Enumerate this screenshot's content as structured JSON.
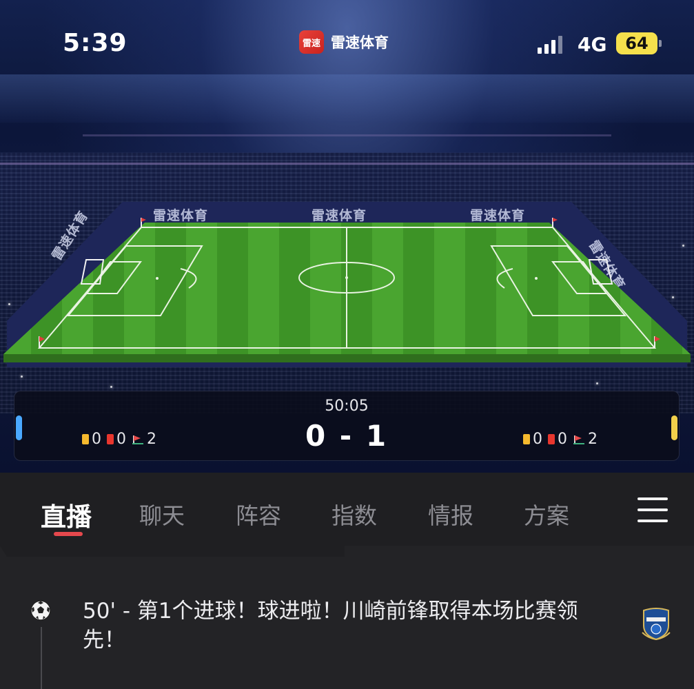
{
  "status_bar": {
    "time": "5:39",
    "network": "4G",
    "battery": "64",
    "signal_bars": 4,
    "app_name": "雷速体育",
    "app_logo_text": "雷速"
  },
  "stadium": {
    "ad_boards": [
      "雷速体育",
      "雷速体育",
      "雷速体育",
      "雷速体育",
      "雷速体育"
    ]
  },
  "scoreboard": {
    "match_time": "50:05",
    "score": "0 - 1",
    "home": {
      "yellow": "0",
      "red": "0",
      "corners": "2",
      "color": "#4aa8ff"
    },
    "away": {
      "yellow": "0",
      "red": "0",
      "corners": "2",
      "color": "#f2d04b"
    }
  },
  "tabs": [
    {
      "label": "直播",
      "active": true
    },
    {
      "label": "聊天",
      "active": false
    },
    {
      "label": "阵容",
      "active": false
    },
    {
      "label": "指数",
      "active": false
    },
    {
      "label": "情报",
      "active": false
    },
    {
      "label": "方案",
      "active": false
    }
  ],
  "feed": {
    "events": [
      {
        "icon": "soccer-ball-icon",
        "text": "50' - 第1个进球！球进啦！川崎前锋取得本场比赛领先！",
        "team_badge": "kawasaki-crest-icon"
      }
    ]
  },
  "colors": {
    "accent": "#e5484d",
    "yellow_card": "#f5b92e",
    "red_card": "#e8362e",
    "pitch": "#3f9a2a"
  }
}
